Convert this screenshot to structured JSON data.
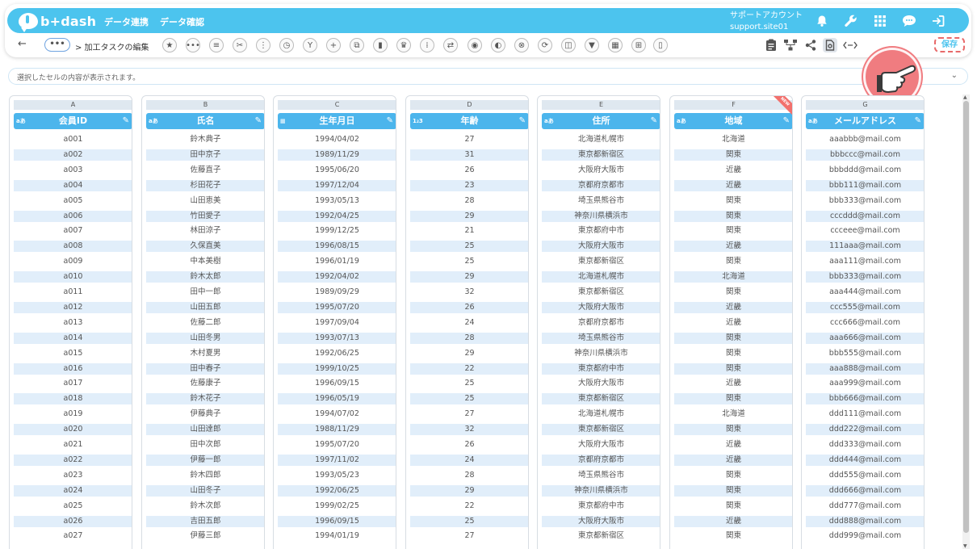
{
  "header": {
    "logo_text": "b+dash",
    "nav": [
      "データ連携",
      "データ確認"
    ],
    "account_line1": "サポートアカウント",
    "account_line2": "support.site01"
  },
  "toolbar": {
    "back": "←",
    "more": "•••",
    "breadcrumb": "> 加工タスクの編集",
    "tools": [
      "★",
      "•••",
      "≡",
      "✂",
      "⋮",
      "◷",
      "Y",
      "+",
      "⧉",
      "▮",
      "♛",
      "⁞",
      "⇄",
      "◉",
      "◐",
      "⊗",
      "⟳",
      "◫",
      "▼",
      "▦",
      "⊞",
      "▯"
    ],
    "save_label": "保存"
  },
  "infobar": {
    "text": "選択したセルの内容が表示されます。",
    "chevron": "⌄"
  },
  "columns": [
    {
      "letter": "A",
      "type": "aあ",
      "label": "会員ID"
    },
    {
      "letter": "B",
      "type": "aあ",
      "label": "氏名"
    },
    {
      "letter": "C",
      "type": "▦",
      "label": "生年月日"
    },
    {
      "letter": "D",
      "type": "1₂3",
      "label": "年齢"
    },
    {
      "letter": "E",
      "type": "aあ",
      "label": "住所"
    },
    {
      "letter": "F",
      "type": "aあ",
      "label": "地域",
      "badge": "NEW"
    },
    {
      "letter": "G",
      "type": "aあ",
      "label": "メールアドレス"
    }
  ],
  "rows": [
    [
      "a001",
      "鈴木典子",
      "1994/04/02",
      "27",
      "北海道札幌市",
      "北海道",
      "aaabbb@mail.com"
    ],
    [
      "a002",
      "田中京子",
      "1989/11/29",
      "31",
      "東京都新宿区",
      "関東",
      "bbbccc@mail.com"
    ],
    [
      "a003",
      "佐藤直子",
      "1995/06/20",
      "26",
      "大阪府大阪市",
      "近畿",
      "bbbddd@mail.com"
    ],
    [
      "a004",
      "杉田花子",
      "1997/12/04",
      "23",
      "京都府京都市",
      "近畿",
      "bbb111@mail.com"
    ],
    [
      "a005",
      "山田恵美",
      "1993/05/13",
      "28",
      "埼玉県熊谷市",
      "関東",
      "bbb333@mail.com"
    ],
    [
      "a006",
      "竹田愛子",
      "1992/04/25",
      "29",
      "神奈川県横浜市",
      "関東",
      "cccddd@mail.com"
    ],
    [
      "a007",
      "林田涼子",
      "1999/12/25",
      "21",
      "東京都府中市",
      "関東",
      "ccceee@mail.com"
    ],
    [
      "a008",
      "久保直美",
      "1996/08/15",
      "25",
      "大阪府大阪市",
      "近畿",
      "111aaa@mail.com"
    ],
    [
      "a009",
      "中本美樹",
      "1996/01/19",
      "25",
      "東京都新宿区",
      "関東",
      "aaa111@mail.com"
    ],
    [
      "a010",
      "鈴木太郎",
      "1992/04/02",
      "29",
      "北海道札幌市",
      "北海道",
      "bbb333@mail.com"
    ],
    [
      "a011",
      "田中一郎",
      "1989/09/29",
      "32",
      "東京都新宿区",
      "関東",
      "aaa444@mail.com"
    ],
    [
      "a012",
      "山田五郎",
      "1995/07/20",
      "26",
      "大阪府大阪市",
      "近畿",
      "ccc555@mail.com"
    ],
    [
      "a013",
      "佐藤二郎",
      "1997/09/04",
      "24",
      "京都府京都市",
      "近畿",
      "ccc666@mail.com"
    ],
    [
      "a014",
      "山田冬男",
      "1993/07/13",
      "28",
      "埼玉県熊谷市",
      "関東",
      "aaa666@mail.com"
    ],
    [
      "a015",
      "木村夏男",
      "1992/06/25",
      "29",
      "神奈川県横浜市",
      "関東",
      "bbb555@mail.com"
    ],
    [
      "a016",
      "田中春子",
      "1999/10/25",
      "22",
      "東京都府中市",
      "関東",
      "aaa888@mail.com"
    ],
    [
      "a017",
      "佐藤康子",
      "1996/09/15",
      "25",
      "大阪府大阪市",
      "近畿",
      "aaa999@mail.com"
    ],
    [
      "a018",
      "鈴木花子",
      "1996/05/19",
      "25",
      "東京都新宿区",
      "関東",
      "bbb666@mail.com"
    ],
    [
      "a019",
      "伊藤典子",
      "1994/07/02",
      "27",
      "北海道札幌市",
      "北海道",
      "ddd111@mail.com"
    ],
    [
      "a020",
      "山田達郎",
      "1988/11/29",
      "32",
      "東京都新宿区",
      "関東",
      "ddd222@mail.com"
    ],
    [
      "a021",
      "田中次郎",
      "1995/07/20",
      "26",
      "大阪府大阪市",
      "近畿",
      "ddd333@mail.com"
    ],
    [
      "a022",
      "伊藤一郎",
      "1997/11/02",
      "24",
      "京都府京都市",
      "近畿",
      "ddd444@mail.com"
    ],
    [
      "a023",
      "鈴木四郎",
      "1993/05/23",
      "28",
      "埼玉県熊谷市",
      "関東",
      "ddd555@mail.com"
    ],
    [
      "a024",
      "山田冬子",
      "1992/06/25",
      "29",
      "神奈川県横浜市",
      "関東",
      "ddd666@mail.com"
    ],
    [
      "a025",
      "鈴木次郎",
      "1999/02/25",
      "22",
      "東京都府中市",
      "関東",
      "ddd777@mail.com"
    ],
    [
      "a026",
      "吉田五郎",
      "1996/09/15",
      "25",
      "大阪府大阪市",
      "近畿",
      "ddd888@mail.com"
    ],
    [
      "a027",
      "伊藤三郎",
      "1994/01/19",
      "27",
      "東京都新宿区",
      "関東",
      "ddd999@mail.com"
    ]
  ],
  "colors": {
    "accent": "#4cc4ee",
    "header": "#4cb5ec",
    "alt_row": "#e1eefa",
    "pointer": "#f07c80"
  }
}
